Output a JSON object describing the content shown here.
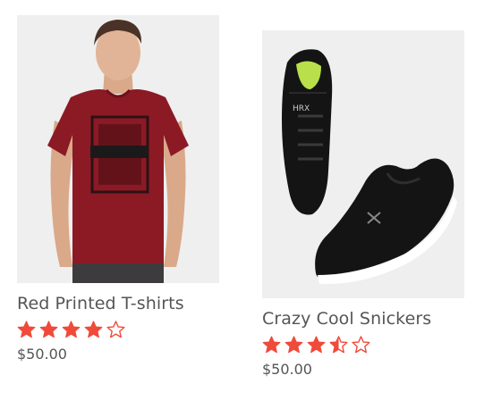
{
  "theme": {
    "star_color": "#f04a3a",
    "text_color": "#555555",
    "image_bg": "#efefef"
  },
  "products": [
    {
      "title": "Red Printed T-shirts",
      "price": "$50.00",
      "rating": 4,
      "rating_max": 5,
      "image_icon": "man-red-tshirt-photo"
    },
    {
      "title": "Crazy Cool Snickers",
      "price": "$50.00",
      "rating": 3.5,
      "rating_max": 5,
      "image_icon": "black-sneakers-photo"
    }
  ]
}
